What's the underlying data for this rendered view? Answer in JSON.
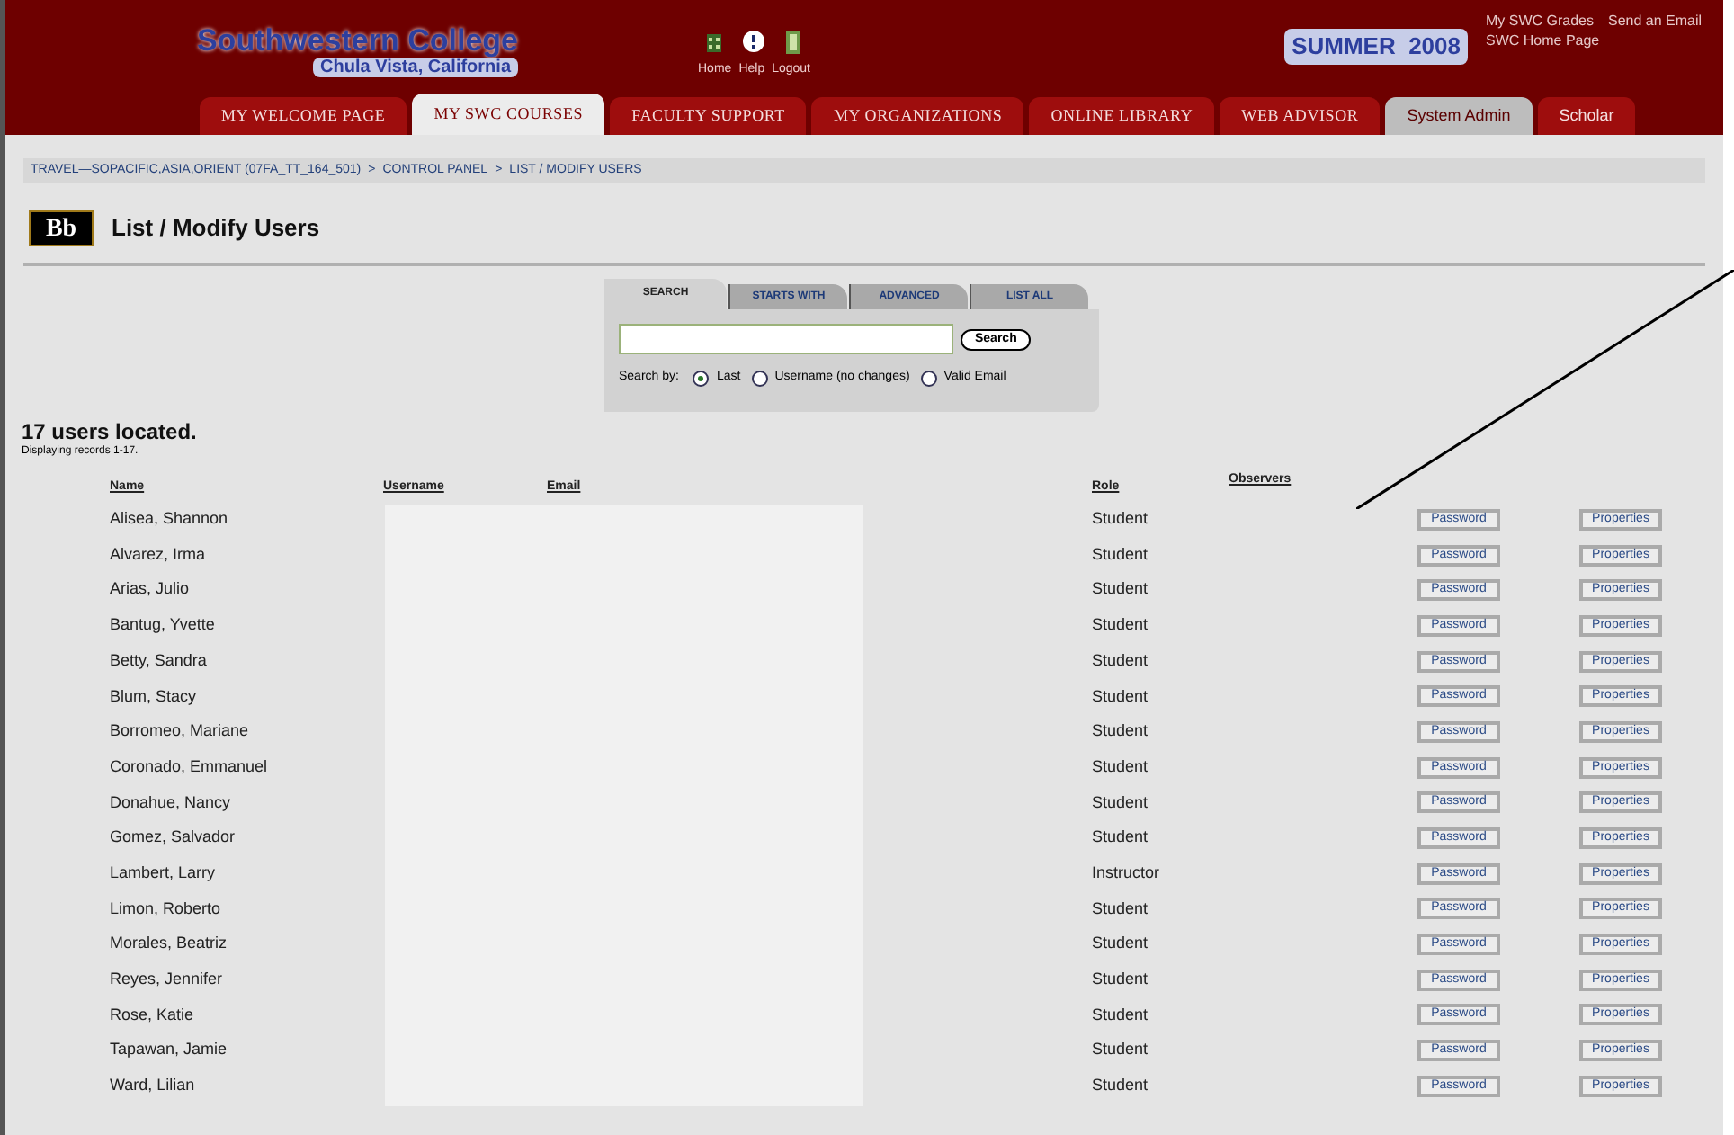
{
  "header": {
    "college": "Southwestern College",
    "location": "Chula Vista, California",
    "tools": [
      {
        "kind": "home",
        "label": "Home"
      },
      {
        "kind": "help",
        "label": "Help"
      },
      {
        "kind": "logout",
        "label": "Logout"
      }
    ],
    "term": "SUMMER  2008",
    "links": [
      "My SWC Grades",
      "Send an Email",
      "SWC Home Page"
    ]
  },
  "tabs": [
    {
      "label": "MY WELCOME PAGE",
      "kind": "portal",
      "selected": false
    },
    {
      "label": "MY SWC COURSES",
      "kind": "portal",
      "selected": true
    },
    {
      "label": "FACULTY SUPPORT",
      "kind": "portal",
      "selected": false
    },
    {
      "label": "MY ORGANIZATIONS",
      "kind": "portal",
      "selected": false
    },
    {
      "label": "ONLINE LIBRARY",
      "kind": "portal",
      "selected": false
    },
    {
      "label": "WEB ADVISOR",
      "kind": "portal",
      "selected": false
    },
    {
      "label": "System Admin",
      "kind": "admin",
      "selected": false
    },
    {
      "label": "Scholar",
      "kind": "plain",
      "selected": false
    }
  ],
  "breadcrumb": {
    "separator": ">",
    "items": [
      "TRAVEL—SOPACIFIC,ASIA,ORIENT (07FA_TT_164_501)",
      "CONTROL PANEL",
      "LIST / MODIFY USERS"
    ]
  },
  "page_title": {
    "logo": "Bb",
    "title": "List / Modify Users"
  },
  "search": {
    "tabs": [
      {
        "label": "SEARCH",
        "selected": true
      },
      {
        "label": "STARTS WITH",
        "selected": false
      },
      {
        "label": "ADVANCED",
        "selected": false
      },
      {
        "label": "LIST ALL",
        "selected": false
      }
    ],
    "button": "Search",
    "search_by_label": "Search by:",
    "options": [
      {
        "label": "Last",
        "selected": true
      },
      {
        "label": "Username (no changes)",
        "selected": false
      },
      {
        "label": "Valid Email",
        "selected": false
      }
    ]
  },
  "summary": {
    "count": "17 users located.",
    "records": "Displaying records 1-17."
  },
  "table": {
    "columns": [
      "Name",
      "Username",
      "Email",
      "Role",
      "Observers"
    ],
    "rows": [
      {
        "name": "Alisea, Shannon",
        "role": "Student",
        "password": "Password",
        "properties": "Properties"
      },
      {
        "name": "Alvarez, Irma",
        "role": "Student",
        "password": "Password",
        "properties": "Properties"
      },
      {
        "name": "Arias, Julio",
        "role": "Student",
        "password": "Password",
        "properties": "Properties"
      },
      {
        "name": "Bantug, Yvette",
        "role": "Student",
        "password": "Password",
        "properties": "Properties"
      },
      {
        "name": "Betty, Sandra",
        "role": "Student",
        "password": "Password",
        "properties": "Properties"
      },
      {
        "name": "Blum, Stacy",
        "role": "Student",
        "password": "Password",
        "properties": "Properties"
      },
      {
        "name": "Borromeo, Mariane",
        "role": "Student",
        "password": "Password",
        "properties": "Properties"
      },
      {
        "name": "Coronado, Emmanuel",
        "role": "Student",
        "password": "Password",
        "properties": "Properties"
      },
      {
        "name": "Donahue, Nancy",
        "role": "Student",
        "password": "Password",
        "properties": "Properties"
      },
      {
        "name": "Gomez, Salvador",
        "role": "Student",
        "password": "Password",
        "properties": "Properties"
      },
      {
        "name": "Lambert, Larry",
        "role": "Instructor",
        "password": "Password",
        "properties": "Properties"
      },
      {
        "name": "Limon, Roberto",
        "role": "Student",
        "password": "Password",
        "properties": "Properties"
      },
      {
        "name": "Morales, Beatriz",
        "role": "Student",
        "password": "Password",
        "properties": "Properties"
      },
      {
        "name": "Reyes, Jennifer",
        "role": "Student",
        "password": "Password",
        "properties": "Properties"
      },
      {
        "name": "Rose, Katie",
        "role": "Student",
        "password": "Password",
        "properties": "Properties"
      },
      {
        "name": "Tapawan, Jamie",
        "role": "Student",
        "password": "Password",
        "properties": "Properties"
      },
      {
        "name": "Ward, Lilian",
        "role": "Student",
        "password": "Password",
        "properties": "Properties"
      }
    ]
  }
}
